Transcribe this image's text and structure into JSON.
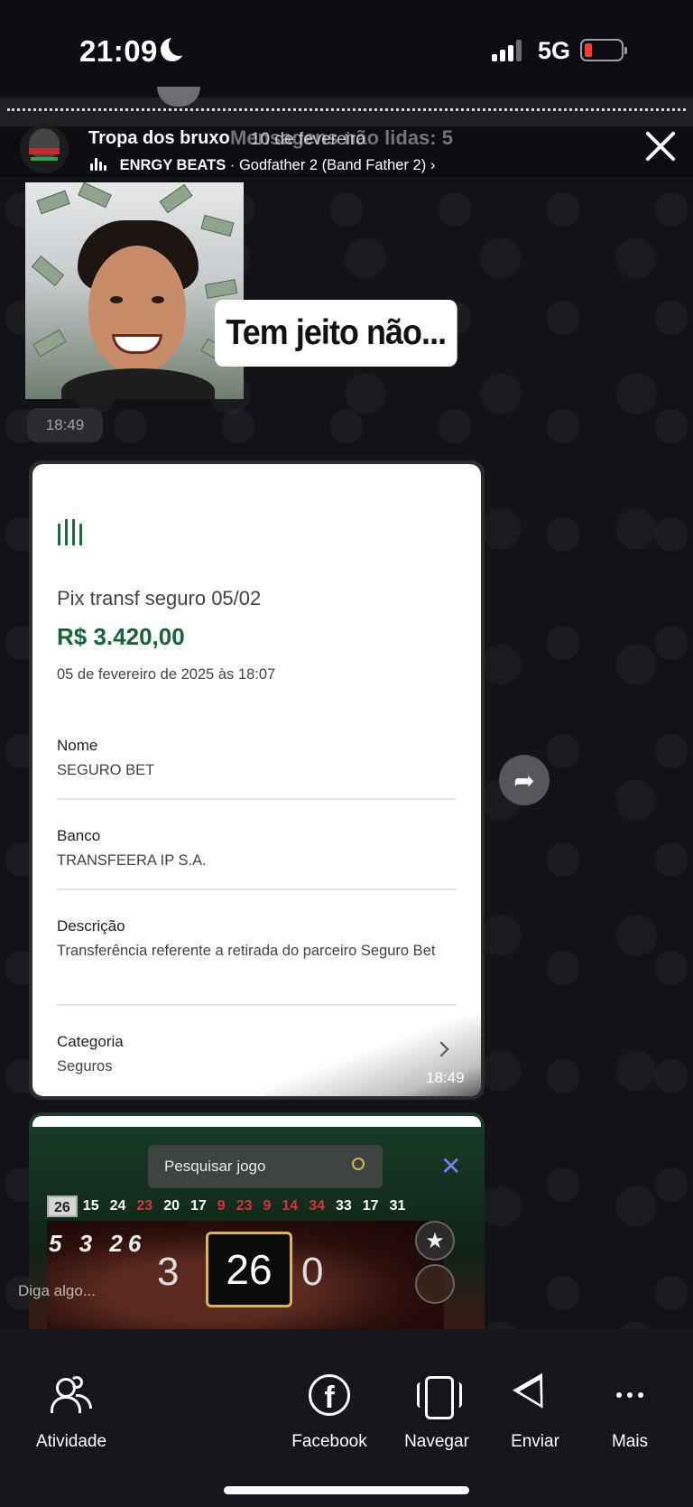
{
  "status_bar": {
    "time": "21:09",
    "network": "5G",
    "battery_level": 0.15,
    "battery_color": "#ff3b30"
  },
  "story": {
    "title": "Tropa dos bruxo",
    "overlay_text": "Mensagens não lidas: 5",
    "overlay_date": "10 de fevereiro",
    "music_artist": "ENRGY BEATS",
    "music_track": "· Godfather 2 (Band Father 2)",
    "music_chevron": "›",
    "close_icon": "close-icon"
  },
  "chat": {
    "meme_caption": "Tem jeito não...",
    "meme_time": "18:49",
    "receipt": {
      "title": "Pix transf seguro 05/02",
      "amount": "R$ 3.420,00",
      "amount_color": "#15643a",
      "date": "05 de fevereiro de 2025 às 18:07",
      "fields": [
        {
          "label": "Nome",
          "value": "SEGURO BET"
        },
        {
          "label": "Banco",
          "value": "TRANSFEERA IP S.A."
        },
        {
          "label": "Descrição",
          "value": "Transferência referente a retirada do parceiro Seguro Bet"
        },
        {
          "label": "Categoria",
          "value": "Seguros"
        }
      ],
      "time": "18:49"
    },
    "forward_icon": "➦",
    "casino": {
      "search_placeholder": "Pesquisar jogo",
      "close_label": "✕",
      "history": [
        {
          "n": "26",
          "style": "first"
        },
        {
          "n": "15",
          "style": "white"
        },
        {
          "n": "24",
          "style": "white"
        },
        {
          "n": "23",
          "style": "red"
        },
        {
          "n": "20",
          "style": "white"
        },
        {
          "n": "17",
          "style": "white"
        },
        {
          "n": "9",
          "style": "red"
        },
        {
          "n": "23",
          "style": "red"
        },
        {
          "n": "9",
          "style": "red"
        },
        {
          "n": "14",
          "style": "red"
        },
        {
          "n": "34",
          "style": "red"
        },
        {
          "n": "33",
          "style": "white"
        },
        {
          "n": "17",
          "style": "white"
        },
        {
          "n": "31",
          "style": "white"
        }
      ],
      "wheel_numbers": "5 3 26",
      "left_number": "3",
      "result": "26",
      "right_number": "0",
      "star_icon": "★"
    },
    "reply_placeholder": "Diga algo..."
  },
  "bottom_bar": {
    "items": [
      {
        "label": "Atividade",
        "icon": "people-icon"
      },
      {
        "label": "Facebook",
        "icon": "facebook-icon"
      },
      {
        "label": "Navegar",
        "icon": "phone-browse-icon"
      },
      {
        "label": "Enviar",
        "icon": "send-icon"
      },
      {
        "label": "Mais",
        "icon": "more-icon"
      }
    ],
    "facebook_glyph": "f"
  }
}
